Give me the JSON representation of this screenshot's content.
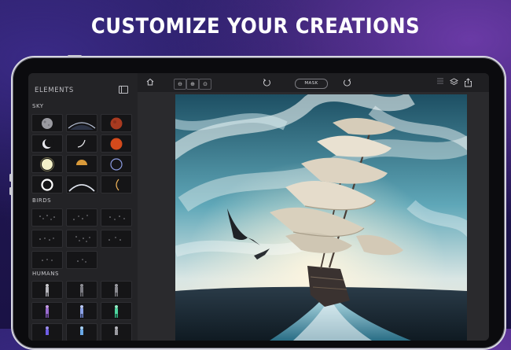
{
  "headline": "CUSTOMIZE YOUR CREATIONS",
  "sidebar": {
    "title": "ELEMENTS",
    "sections": [
      {
        "label": "SKY",
        "items": [
          "moon",
          "planet-horizon",
          "red-moon",
          "crescent-moon",
          "crescent-moon-thin",
          "orange-sun",
          "sun",
          "golden-planet",
          "eclipse-ring",
          "bright-ring",
          "arc-horizon",
          "ring-edge"
        ]
      },
      {
        "label": "BIRDS",
        "items": [
          "bird-flock",
          "bird-flock",
          "bird-flock",
          "bird-flock",
          "bird-flock",
          "bird-flock",
          "bird-flock",
          "bird-flock"
        ]
      },
      {
        "label": "HUMANS",
        "items": [
          "human-figure",
          "human-figure",
          "human-figure",
          "human-figure",
          "human-figure",
          "human-figure",
          "human-figure",
          "human-figure",
          "human-figure"
        ]
      }
    ]
  },
  "toolbar": {
    "mask_label": "MASK",
    "icons": [
      "home-icon",
      "zoom-out-icon",
      "zoom-in-icon",
      "zoom-fit-icon",
      "undo-icon",
      "redo-icon",
      "menu-icon",
      "layers-icon",
      "share-icon"
    ]
  },
  "colors": {
    "accent": "#3a2a86",
    "panel": "#232326",
    "frame": "#d7d7e0"
  }
}
